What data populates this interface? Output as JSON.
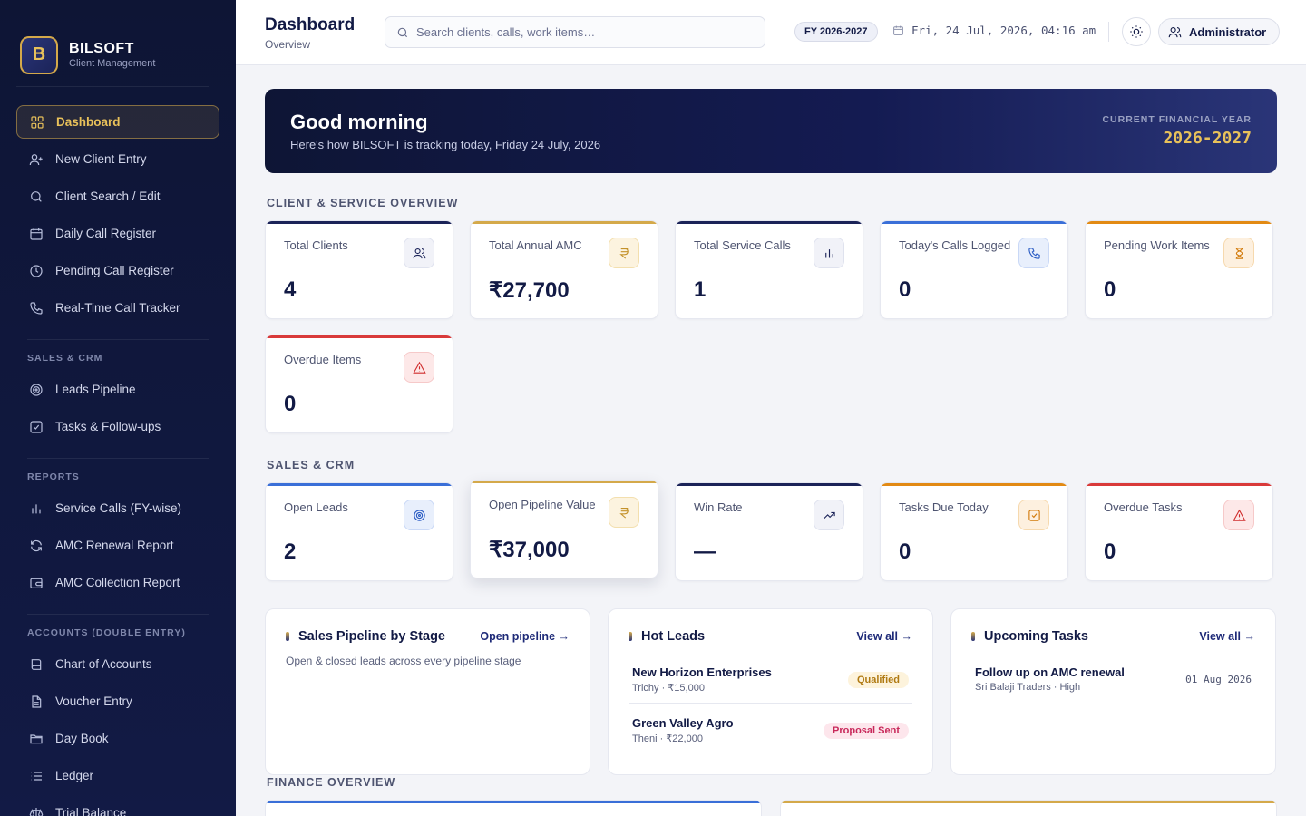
{
  "brand": {
    "logo_letter": "B",
    "name": "BILSOFT",
    "subtitle": "Client Management"
  },
  "nav": {
    "main": [
      {
        "label": "Dashboard",
        "icon": "grid-icon",
        "active": true
      },
      {
        "label": "New Client Entry",
        "icon": "user-plus-icon"
      },
      {
        "label": "Client Search / Edit",
        "icon": "search-icon"
      },
      {
        "label": "Daily Call Register",
        "icon": "calendar-icon"
      },
      {
        "label": "Pending Call Register",
        "icon": "clock-icon"
      },
      {
        "label": "Real-Time Call Tracker",
        "icon": "phone-icon"
      }
    ],
    "sections": [
      {
        "title": "SALES & CRM",
        "items": [
          {
            "label": "Leads Pipeline",
            "icon": "target-icon"
          },
          {
            "label": "Tasks & Follow-ups",
            "icon": "check-square-icon"
          }
        ]
      },
      {
        "title": "REPORTS",
        "items": [
          {
            "label": "Service Calls (FY-wise)",
            "icon": "bar-chart-icon"
          },
          {
            "label": "AMC Renewal Report",
            "icon": "refresh-icon"
          },
          {
            "label": "AMC Collection Report",
            "icon": "wallet-icon"
          }
        ]
      },
      {
        "title": "ACCOUNTS (DOUBLE ENTRY)",
        "items": [
          {
            "label": "Chart of Accounts",
            "icon": "book-icon"
          },
          {
            "label": "Voucher Entry",
            "icon": "file-icon"
          },
          {
            "label": "Day Book",
            "icon": "folder-icon"
          },
          {
            "label": "Ledger",
            "icon": "list-icon"
          },
          {
            "label": "Trial Balance",
            "icon": "scale-icon"
          }
        ]
      }
    ]
  },
  "header": {
    "title": "Dashboard",
    "subtitle": "Overview",
    "search_placeholder": "Search clients, calls, work items…",
    "fy_badge": "FY 2026-2027",
    "datetime": "Fri, 24 Jul, 2026, 04:16 am",
    "user": "Administrator"
  },
  "hero": {
    "greeting": "Good morning",
    "subtitle": "Here's how BILSOFT is tracking today, Friday 24 July, 2026",
    "fy_label": "CURRENT FINANCIAL YEAR",
    "fy_value": "2026-2027"
  },
  "client_overview": {
    "title": "CLIENT & SERVICE OVERVIEW",
    "cards": [
      {
        "label": "Total Clients",
        "value": "4",
        "icon": "users-icon",
        "accent": "#1b2358"
      },
      {
        "label": "Total Annual AMC",
        "value": "₹27,700",
        "icon": "rupee-icon",
        "accent": "#d4a94a"
      },
      {
        "label": "Total Service Calls",
        "value": "1",
        "icon": "bar-chart-icon",
        "accent": "#1b2358"
      },
      {
        "label": "Today's Calls Logged",
        "value": "0",
        "icon": "phone-icon",
        "accent": "#3a6fd8"
      },
      {
        "label": "Pending Work Items",
        "value": "0",
        "icon": "hourglass-icon",
        "accent": "#e28a14"
      },
      {
        "label": "Overdue Items",
        "value": "0",
        "icon": "alert-icon",
        "accent": "#d93a3a"
      }
    ]
  },
  "sales_crm": {
    "title": "SALES & CRM",
    "cards": [
      {
        "label": "Open Leads",
        "value": "2",
        "icon": "target-icon",
        "accent": "#3a6fd8"
      },
      {
        "label": "Open Pipeline Value",
        "value": "₹37,000",
        "icon": "rupee-icon",
        "accent": "#d4a94a"
      },
      {
        "label": "Win Rate",
        "value": "—",
        "icon": "trending-up-icon",
        "accent": "#1b2358"
      },
      {
        "label": "Tasks Due Today",
        "value": "0",
        "icon": "check-square-icon",
        "accent": "#e28a14"
      },
      {
        "label": "Overdue Tasks",
        "value": "0",
        "icon": "alert-icon",
        "accent": "#d93a3a"
      }
    ]
  },
  "panels": {
    "pipeline": {
      "title": "Sales Pipeline by Stage",
      "link": "Open pipeline →",
      "desc": "Open & closed leads across every pipeline stage"
    },
    "hot_leads": {
      "title": "Hot Leads",
      "link": "View all →",
      "items": [
        {
          "name": "New Horizon Enterprises",
          "meta": "Trichy · ₹15,000",
          "status": "Qualified"
        },
        {
          "name": "Green Valley Agro",
          "meta": "Theni · ₹22,000",
          "status": "Proposal Sent"
        }
      ]
    },
    "tasks": {
      "title": "Upcoming Tasks",
      "link": "View all →",
      "items": [
        {
          "title": "Follow up on AMC renewal",
          "meta": "Sri Balaji Traders · High",
          "date": "01 Aug 2026"
        }
      ]
    }
  },
  "finance": {
    "title": "FINANCE OVERVIEW",
    "accents": [
      "#3a6fd8",
      "#d4a94a"
    ]
  }
}
